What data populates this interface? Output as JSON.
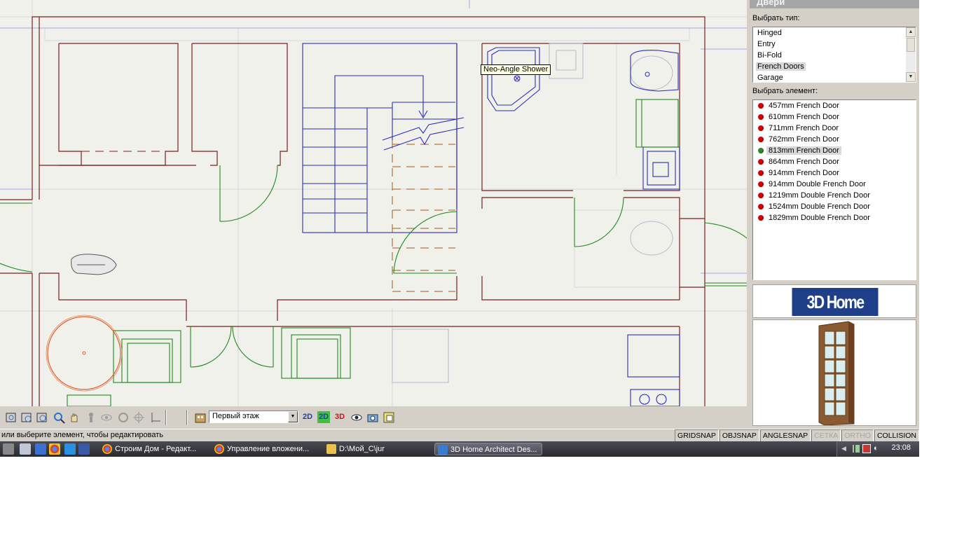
{
  "canvas": {
    "tooltip": "Neo-Angle Shower"
  },
  "panel": {
    "title": "Двери",
    "type_label": "Выбрать тип:",
    "types": [
      "Hinged",
      "Entry",
      "Bi-Fold",
      "French Doors",
      "Garage"
    ],
    "selected_type": "French Doors",
    "element_label": "Выбрать элемент:",
    "elements": [
      "457mm French Door",
      "610mm French Door",
      "711mm French Door",
      "762mm French Door",
      "813mm French Door",
      "864mm French Door",
      "914mm French Door",
      "914mm Double French Door",
      "1219mm Double French Door",
      "1524mm Double French Door",
      "1829mm Double French Door"
    ],
    "selected_element": "813mm French Door",
    "brand": "3D Home Architect"
  },
  "toolbar": {
    "floor_value": "Первый этаж",
    "btn_2d_a": "2D",
    "btn_2d_b": "2D",
    "btn_3d": "3D"
  },
  "statusbar": {
    "text": "или выберите элемент, чтобы редактировать",
    "flags": [
      "GRIDSNAP",
      "OBJSNAP",
      "ANGLESNAP",
      "СЕТКА",
      "ORTHO",
      "COLLISION"
    ],
    "disabled_flags": [
      "СЕТКА",
      "ORTHO"
    ]
  },
  "taskbar": {
    "tasks": [
      {
        "label": "Строим Дом - Редакт...",
        "icon": "chrome-icon"
      },
      {
        "label": "Управление вложени...",
        "icon": "chrome-icon"
      },
      {
        "label": "D:\\Мой_С\\jur",
        "icon": "folder-icon"
      },
      {
        "label": "3D Home Architect Des...",
        "icon": "home-architect-icon"
      }
    ],
    "clock": "23:08"
  },
  "colors": {
    "wall": "#7a1f1f",
    "stairs": "#2b2bbf",
    "door": "#1f8a1f",
    "canvas_bg": "#f1f1ec"
  }
}
